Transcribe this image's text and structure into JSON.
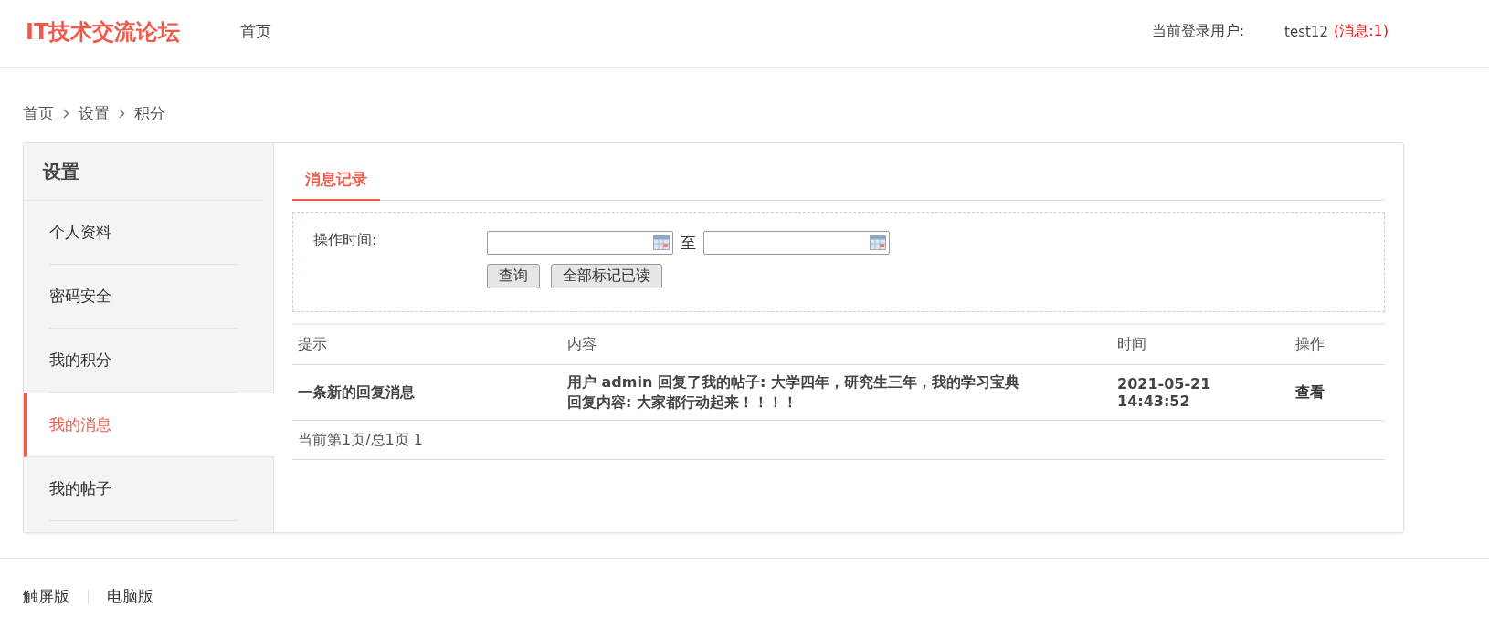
{
  "header": {
    "logo": "IT技术交流论坛",
    "nav": [
      {
        "label": "首页"
      }
    ],
    "user_label": "当前登录用户:",
    "username": "test12",
    "messages": "(消息:1)"
  },
  "breadcrumb": [
    "首页",
    "设置",
    "积分"
  ],
  "sidebar": {
    "title": "设置",
    "items": [
      {
        "label": "个人资料",
        "selected": false
      },
      {
        "label": "密码安全",
        "selected": false
      },
      {
        "label": "我的积分",
        "selected": false
      },
      {
        "label": "我的消息",
        "selected": true
      },
      {
        "label": "我的帖子",
        "selected": false
      }
    ]
  },
  "tabs": [
    {
      "label": "消息记录",
      "selected": true
    }
  ],
  "filter": {
    "label": "操作时间:",
    "range_separator": "至",
    "buttons": [
      "查询",
      "全部标记已读"
    ]
  },
  "table": {
    "columns": [
      "提示",
      "内容",
      "时间",
      "操作"
    ],
    "rows": [
      {
        "hint": "一条新的回复消息",
        "content": [
          "用户 admin 回复了我的帖子: 大学四年，研究生三年，我的学习宝典",
          "回复内容: 大家都行动起来！！！！"
        ],
        "time": "2021-05-21 14:43:52",
        "action": "查看"
      }
    ],
    "pagination": "当前第1页/总1页 1"
  },
  "footer": [
    "触屏版",
    "电脑版"
  ]
}
